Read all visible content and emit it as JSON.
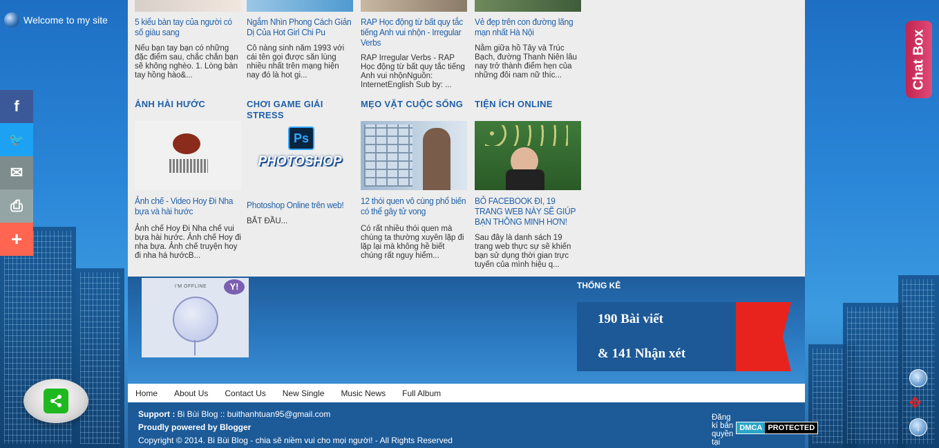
{
  "welcome": "Welcome to my site",
  "share_bar": [
    {
      "icon": "facebook-icon",
      "glyph": "f"
    },
    {
      "icon": "twitter-icon",
      "glyph": "🐦"
    },
    {
      "icon": "email-icon",
      "glyph": "✉"
    },
    {
      "icon": "print-icon",
      "glyph": "⎙"
    },
    {
      "icon": "plus-icon",
      "glyph": "+"
    }
  ],
  "top_posts": [
    {
      "title": "5 kiểu bàn tay của người có số giàu sang",
      "desc": "Nếu bạn tay bạn có những đặc điểm sau, chắc chắn bạn sẽ không nghèo. 1. Lòng bàn tay hồng hào&..."
    },
    {
      "title": "Ngắm Nhìn Phong Cách Giản Dị Của Hot Girl Chi Pu",
      "desc": "Cô nàng sinh năm 1993 với cái tên gọi được săn lùng nhiều nhất trên mạng hiện nay đó là hot gi..."
    },
    {
      "title": "RAP Học động từ bất quy tắc tiếng Anh vui nhộn - Irregular Verbs",
      "desc": "RAP Irregular Verbs - RAP Học động từ bất quy tắc tiếng Anh vui nhộnNguồn: InternetEnglish Sub by: ..."
    },
    {
      "title": "Vẻ đẹp trên con đường lãng mạn nhất Hà Nội",
      "desc": "Nằm giữa hồ Tây và Trúc Bạch, đường Thanh Niên lâu nay trở thành điểm hẹn của những đôi nam nữ thíc..."
    }
  ],
  "categories": [
    {
      "cat": "ẢNH HÀI HƯỚC",
      "title": "Ảnh chế - Video Hoy Đi Nha bựa và hài hước",
      "desc": "Ảnh chế Hoy Đi Nha chế vui bựa hài hước. Ảnh chế Hoy đi nha bựa. Ảnh chế truyện hoy đi nha há hướcB..."
    },
    {
      "cat": "CHƠI GAME GIẢI STRESS",
      "title": "Photoshop Online trên web!",
      "desc": "BẮT ĐẦU...",
      "img_text": "PHOTOSHOP",
      "img_badge": "Ps"
    },
    {
      "cat": "MẸO VẶT CUỘC SỐNG",
      "title": "12 thói quen vô cùng phổ biến có thể gây tử vong",
      "desc": "Có rất nhiều thói quen mà chúng ta thường xuyên lặp đi lặp lại mà không hề biết chúng rất nguy hiểm..."
    },
    {
      "cat": "TIỆN ÍCH ONLINE",
      "title": "BỎ FACEBOOK ĐI, 19 TRANG WEB NÀY SẼ GIÚP BẠN THÔNG MINH HƠN!",
      "desc": "Sau đây là danh sách 19 trang web thực sự sẽ khiến bạn sử dụng thời gian trực tuyến của mình hiệu q..."
    }
  ],
  "yahoo": {
    "status": "I'M OFFLINE",
    "logo": "Y!"
  },
  "stats": {
    "heading": "THỐNG KÊ",
    "posts": "190 Bài viết",
    "comments": "& 141 Nhận xét"
  },
  "nav": [
    "Home",
    "About Us",
    "Contact Us",
    "New Single",
    "Music News",
    "Full Album"
  ],
  "footer": {
    "support_label": "Support :",
    "support_text": "Bi Bùi Blog :: buithanhtuan95@gmail.com",
    "powered": "Proudly powered by Blogger",
    "copyright": "Copyright © 2014. Bi Bùi Blog - chia sẽ niềm vui cho mọi người! - All Rights Reserved",
    "dmca_label": "Đăng kí bản quyền tại",
    "dmca_left": "DMCA",
    "dmca_right": "PROTECTED"
  },
  "chatbox": "Chat Box",
  "colors": {
    "accent": "#1f5fa8",
    "footer": "#1c5a98",
    "chatbox": "#d23a65",
    "ribbon": "#e8231e"
  }
}
